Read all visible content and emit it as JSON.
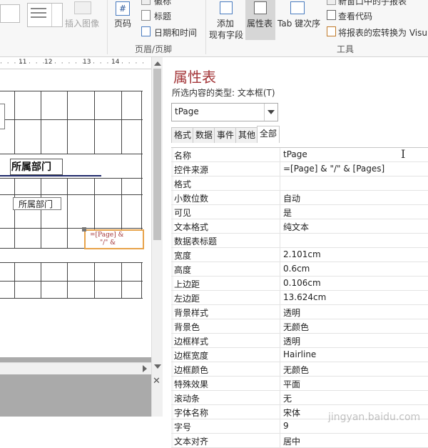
{
  "ribbon": {
    "insert_image": "插入图像",
    "page_number": "页码",
    "logo_partial": "徽标",
    "title": "标题",
    "date_time": "日期和时间",
    "group_header_footer": "页眉/页脚",
    "add_existing_fields": [
      "添加",
      "现有字段"
    ],
    "property_sheet": "属性表",
    "tab_order": "Tab 键次序",
    "top_partial": "新窗口中的子报表",
    "view_code": "查看代码",
    "convert_macros": "将报表的宏转换为 Visu",
    "group_tools": "工具"
  },
  "design": {
    "ruler_labels": [
      "11",
      "12",
      "13",
      "14"
    ],
    "label_bold": "所属部门",
    "label_normal": "所属部门",
    "textbox_line1": "=[Page] &",
    "textbox_line2": "\"/\" &"
  },
  "property_sheet": {
    "title": "属性表",
    "selection_type_label": "所选内容的类型: 文本框(T)",
    "selected_control": "tPage",
    "tabs": [
      "格式",
      "数据",
      "事件",
      "其他",
      "全部"
    ],
    "active_tab": "全部",
    "rows": [
      {
        "name": "名称",
        "value": "tPage"
      },
      {
        "name": "控件来源",
        "value": "=[Page] & \"/\" & [Pages]"
      },
      {
        "name": "格式",
        "value": ""
      },
      {
        "name": "小数位数",
        "value": "自动"
      },
      {
        "name": "可见",
        "value": "是"
      },
      {
        "name": "文本格式",
        "value": "纯文本"
      },
      {
        "name": "数据表标题",
        "value": ""
      },
      {
        "name": "宽度",
        "value": "2.101cm"
      },
      {
        "name": "高度",
        "value": "0.6cm"
      },
      {
        "name": "上边距",
        "value": "0.106cm"
      },
      {
        "name": "左边距",
        "value": "13.624cm"
      },
      {
        "name": "背景样式",
        "value": "透明"
      },
      {
        "name": "背景色",
        "value": "无颜色"
      },
      {
        "name": "边框样式",
        "value": "透明"
      },
      {
        "name": "边框宽度",
        "value": "Hairline"
      },
      {
        "name": "边框颜色",
        "value": "无颜色"
      },
      {
        "name": "特殊效果",
        "value": "平面"
      },
      {
        "name": "滚动条",
        "value": "无"
      },
      {
        "name": "字体名称",
        "value": "宋体"
      },
      {
        "name": "字号",
        "value": "9"
      },
      {
        "name": "文本对齐",
        "value": "居中"
      }
    ]
  },
  "colors": {
    "accent": "#a4373a",
    "selection_orange": "#e8a34a",
    "navy_line": "#1f2a6b",
    "active_ribbon_button": "#d6d6d6"
  },
  "watermark": "jingyan.baidu.com"
}
